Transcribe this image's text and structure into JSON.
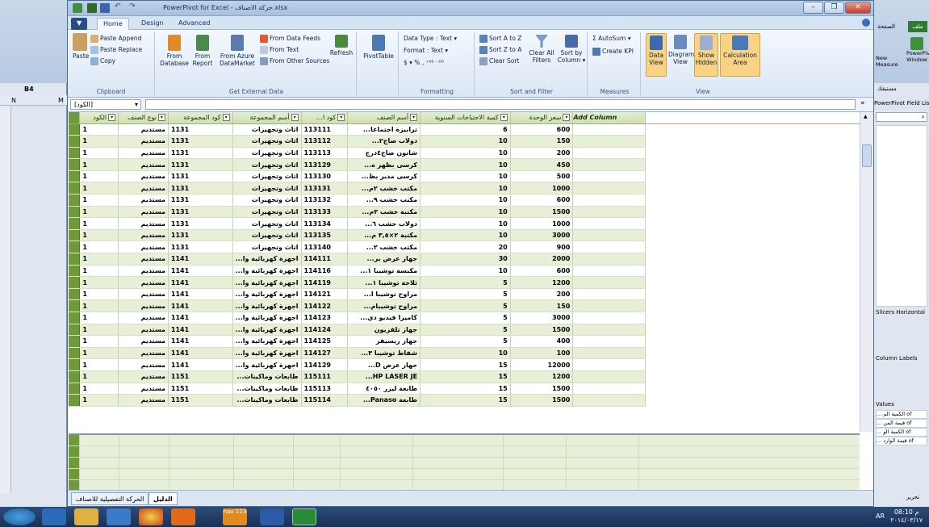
{
  "window": {
    "title": "PowerPivot for Excel - حركة الاصناف.xlsx",
    "minimize": "–",
    "maximize": "❐",
    "close": "✕"
  },
  "excel_left": {
    "cell_ref": "B4",
    "col_n": "N",
    "col_m": "M"
  },
  "excel_right": {
    "tab_file": "ملف",
    "tab_page": "الصفحة",
    "powerpivot_window": "PowerPivot Window",
    "new_label": "New",
    "measure_label": "Measure",
    "more_label": "مستبقك",
    "field_list": "PowerPivot Field List",
    "slicers_horizontal": "Slicers Horizontal",
    "column_labels": "Column Labels",
    "values_title": "Values",
    "values_items": [
      "... الكمية الم of",
      "... قيمة المن of",
      "... الكمية الو of",
      "... قيمة الوارد of"
    ],
    "footer_label": "تحرير"
  },
  "tabs": [
    "Home",
    "Design",
    "Advanced"
  ],
  "file_menu": "▼",
  "ribbon": {
    "clipboard": {
      "label": "Clipboard",
      "paste": "Paste",
      "paste_append": "Paste Append",
      "paste_replace": "Paste Replace",
      "copy": "Copy"
    },
    "external": {
      "label": "Get External Data",
      "from_database": "From Database",
      "from_report": "From Report",
      "from_azure": "From Azure DataMarket",
      "from_feeds": "From Data Feeds",
      "from_text": "From Text",
      "from_other": "From Other Sources",
      "refresh": "Refresh"
    },
    "pivot": {
      "label": "",
      "pivottable": "PivotTable"
    },
    "formatting": {
      "label": "Formatting",
      "data_type": "Data Type : Text ▾",
      "format": "Format : Text ▾",
      "currency": "$ ▾  %  ,  ⁺⁰⁰  ⁻⁰⁰"
    },
    "sort": {
      "label": "Sort and Filter",
      "sort_az": "Sort A to Z",
      "sort_za": "Sort Z to A",
      "clear_sort": "Clear Sort",
      "clear_all": "Clear All Filters",
      "sort_by": "Sort by Column ▾"
    },
    "measures": {
      "label": "Measures",
      "autosum": "Σ AutoSum ▾",
      "create_kpi": "Create KPI"
    },
    "view": {
      "label": "View",
      "data_view": "Data View",
      "diagram_view": "Diagram View",
      "show_hidden": "Show Hidden",
      "calc_area": "Calculation Area"
    }
  },
  "formula": {
    "name": "[الكود]",
    "fx": "»"
  },
  "columns": [
    "الكود",
    "نوع الصنف",
    "كود المجموعة",
    "أسم المجموعة",
    "...كود ا",
    "أسم الصنف",
    "كمية الاحتياجات السنوية",
    "سعر الوحدة",
    "Add Column"
  ],
  "rows": [
    [
      "1",
      "مستديم",
      "1131",
      "اثاث وتجهيزات",
      "113111",
      "...ترابيزة اجتماعا",
      "6",
      "600"
    ],
    [
      "1",
      "مستديم",
      "1131",
      "اثاث وتجهيزات",
      "113112",
      "...دولاب صاج٢",
      "10",
      "150"
    ],
    [
      "1",
      "مستديم",
      "1131",
      "اثاث وتجهيزات",
      "113113",
      "شانون صاج٤درج",
      "10",
      "200"
    ],
    [
      "1",
      "مستديم",
      "1131",
      "اثاث وتجهيزات",
      "113129",
      "...كرسى بظهر ه",
      "10",
      "450"
    ],
    [
      "1",
      "مستديم",
      "1131",
      "اثاث وتجهيزات",
      "113130",
      "...كرسى مدير بظ",
      "10",
      "500"
    ],
    [
      "1",
      "مستديم",
      "1131",
      "اثاث وتجهيزات",
      "113131",
      "...مكتب خشب ٢م",
      "10",
      "1000"
    ],
    [
      "1",
      "مستديم",
      "1131",
      "اثاث وتجهيزات",
      "113132",
      "...مكتب خشب ٩",
      "10",
      "600"
    ],
    [
      "1",
      "مستديم",
      "1131",
      "اثاث وتجهيزات",
      "113133",
      "...مكتبة خشب ٣م",
      "10",
      "1500"
    ],
    [
      "1",
      "مستديم",
      "1131",
      "اثاث وتجهيزات",
      "113134",
      "...دولاب خشب ٦",
      "10",
      "1000"
    ],
    [
      "1",
      "مستديم",
      "1131",
      "اثاث وتجهيزات",
      "113135",
      "...مكتبة ٢×٣,٥ م",
      "10",
      "3000"
    ],
    [
      "1",
      "مستديم",
      "1131",
      "اثاث وتجهيزات",
      "113140",
      "...مكتب خشب ٢",
      "20",
      "900"
    ],
    [
      "1",
      "مستديم",
      "1141",
      "...اجهزة كهربائية وا",
      "114111",
      "...جهاز عرض بر",
      "30",
      "2000"
    ],
    [
      "1",
      "مستديم",
      "1141",
      "...اجهزة كهربائية وا",
      "114116",
      "...مكنسة توشيبا ١",
      "10",
      "600"
    ],
    [
      "1",
      "مستديم",
      "1141",
      "...اجهزة كهربائية وا",
      "114119",
      "...ثلاجة توشيبا ١",
      "5",
      "1200"
    ],
    [
      "1",
      "مستديم",
      "1141",
      "...اجهزة كهربائية وا",
      "114121",
      "...مراوح توشيبا ا",
      "5",
      "200"
    ],
    [
      "1",
      "مستديم",
      "1141",
      "...اجهزة كهربائية وا",
      "114122",
      "...مراوح توشيبام",
      "5",
      "150"
    ],
    [
      "1",
      "مستديم",
      "1141",
      "...اجهزة كهربائية وا",
      "114123",
      "...كاميرا فيديو دي",
      "5",
      "3000"
    ],
    [
      "1",
      "مستديم",
      "1141",
      "...اجهزة كهربائية وا",
      "114124",
      "جهاز تلفزيون",
      "5",
      "1500"
    ],
    [
      "1",
      "مستديم",
      "1141",
      "...اجهزة كهربائية وا",
      "114125",
      "جهاز ريسيفر",
      "5",
      "400"
    ],
    [
      "1",
      "مستديم",
      "1141",
      "...اجهزة كهربائية وا",
      "114127",
      "...شفاط توشيبا ٣",
      "10",
      "100"
    ],
    [
      "1",
      "مستديم",
      "1141",
      "...اجهزة كهربائية وا",
      "114129",
      "...D جهاز عرض",
      "15",
      "12000"
    ],
    [
      "1",
      "مستديم",
      "1151",
      "...طابعات وماكينات",
      "115111",
      "...HP LASER JE",
      "15",
      "1200"
    ],
    [
      "1",
      "مستديم",
      "1151",
      "...طابعات وماكينات",
      "115113",
      "طابعة ليزر ٤٠٥٠",
      "15",
      "1500"
    ],
    [
      "1",
      "مستديم",
      "1151",
      "...طابعات وماكينات",
      "115114",
      "...Panaso طابعة",
      "15",
      "1500"
    ]
  ],
  "sheets": [
    "الدليل",
    "الحركة التفصيلية للاصناف"
  ],
  "taskbar": {
    "lang": "AR",
    "time": "08:10 م",
    "date": "٢٠١٤/٠٣/١٧",
    "hao": "hao 123"
  }
}
